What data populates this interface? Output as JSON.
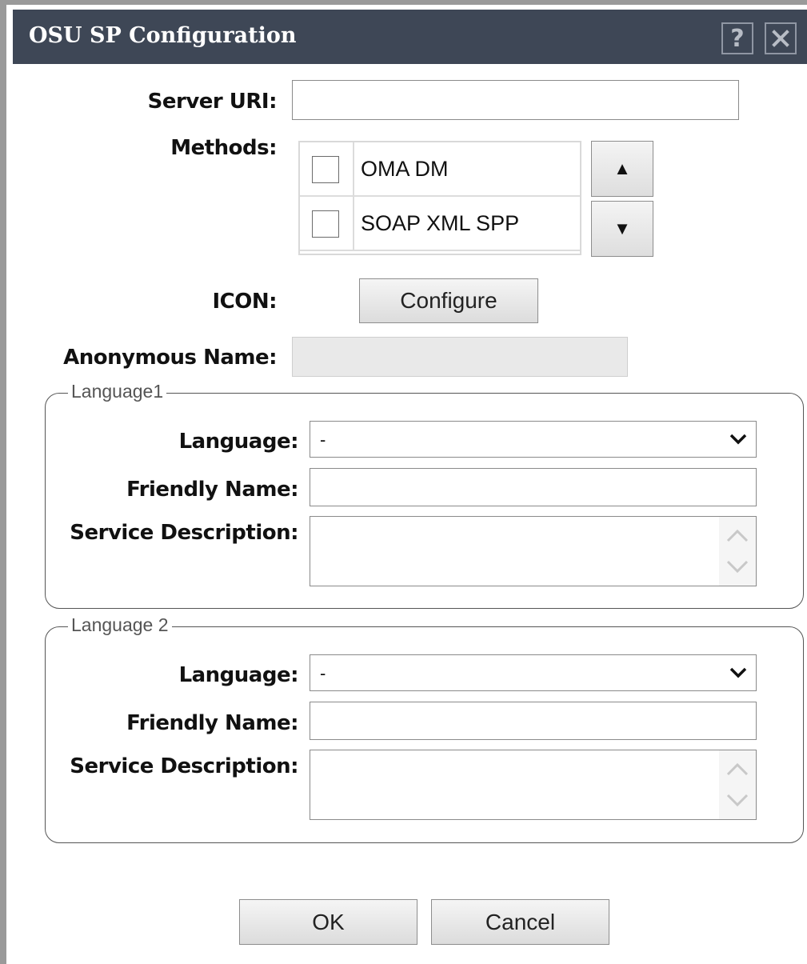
{
  "dialog": {
    "title": "OSU SP Configuration",
    "help_label": "?",
    "close_icon": "close-icon"
  },
  "form": {
    "server_uri_label": "Server URI:",
    "server_uri_value": "",
    "methods_label": "Methods:",
    "methods": [
      {
        "label": "OMA DM",
        "checked": false
      },
      {
        "label": "SOAP XML SPP",
        "checked": false
      }
    ],
    "move_up_symbol": "▲",
    "move_down_symbol": "▼",
    "icon_label": "ICON:",
    "configure_button": "Configure",
    "anonymous_name_label": "Anonymous Name:",
    "anonymous_name_value": ""
  },
  "languages": [
    {
      "legend": "Language1",
      "language_label": "Language:",
      "language_value": "-",
      "friendly_name_label": "Friendly Name:",
      "friendly_name_value": "",
      "service_description_label": "Service Description:",
      "service_description_value": ""
    },
    {
      "legend": "Language 2",
      "language_label": "Language:",
      "language_value": "-",
      "friendly_name_label": "Friendly Name:",
      "friendly_name_value": "",
      "service_description_label": "Service Description:",
      "service_description_value": ""
    }
  ],
  "footer": {
    "ok_button": "OK",
    "cancel_button": "Cancel"
  },
  "colors": {
    "titlebar": "#3e4756",
    "frame": "#9a9a9a",
    "disabled_input": "#e9e9e9"
  }
}
